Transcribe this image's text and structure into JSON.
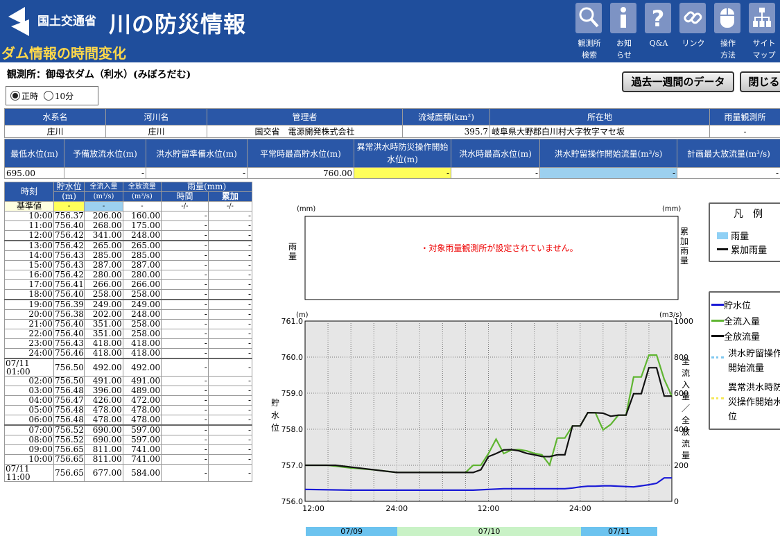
{
  "header": {
    "ministry": "国土交通省",
    "site_title": "川の防災情報",
    "page_subtitle": "ダム情報の時間変化",
    "nav": [
      {
        "icon": "search-icon",
        "label1": "観測所",
        "label2": "検索"
      },
      {
        "icon": "info-icon",
        "label1": "お知",
        "label2": "らせ"
      },
      {
        "icon": "question-icon",
        "label1": "Q&A",
        "label2": ""
      },
      {
        "icon": "link-icon",
        "label1": "リンク",
        "label2": ""
      },
      {
        "icon": "mouse-icon",
        "label1": "操作",
        "label2": "方法"
      },
      {
        "icon": "sitemap-icon",
        "label1": "サイト",
        "label2": "マップ"
      }
    ]
  },
  "station": {
    "text": "観測所：御母衣ダム（利水）(みぼろだむ)"
  },
  "buttons": {
    "past_week": "過去一週間のデータ",
    "close": "閉じる"
  },
  "radio": {
    "opt1": "正時",
    "opt2": "10分"
  },
  "info1": {
    "headers": [
      "水系名",
      "河川名",
      "管理者",
      "流域面積(km²)",
      "所在地",
      "雨量観測所"
    ],
    "values": [
      "庄川",
      "庄川",
      "国交省　電源開発株式会社",
      "395.7",
      "岐阜県大野郡白川村大字牧字マセ坂",
      "-"
    ]
  },
  "info2": {
    "headers": [
      "最低水位(m)",
      "予備放流水位(m)",
      "洪水貯留準備水位(m)",
      "平常時最高貯水位(m)",
      "異常洪水時防災操作開始水位(m)",
      "洪水時最高水位(m)",
      "洪水貯留操作開始流量(m³/s)",
      "計画最大放流量(m³/s)"
    ],
    "values": [
      "695.00",
      "-",
      "-",
      "760.00",
      "-",
      "-",
      "-",
      "-"
    ]
  },
  "data_table": {
    "headers": {
      "time": "時刻",
      "level": "貯水位",
      "level_unit": "(m)",
      "inflow": "全流入量",
      "inflow_unit": "(m³/s)",
      "outflow": "全放流量",
      "outflow_unit": "(m³/s)",
      "rain": "雨量(mm)",
      "rain_hour": "時間",
      "rain_cum": "累加"
    },
    "base_row": {
      "label": "基準値",
      "level": "-",
      "inflow": "-",
      "outflow": "-",
      "rain_hour": "-/-",
      "rain_cum": "-/-"
    },
    "rows": [
      {
        "t": "10:00",
        "lv": "756.37",
        "in": "206.00",
        "out": "160.00",
        "rh": "-",
        "rc": "-"
      },
      {
        "t": "11:00",
        "lv": "756.40",
        "in": "268.00",
        "out": "175.00",
        "rh": "-",
        "rc": "-"
      },
      {
        "t": "12:00",
        "lv": "756.42",
        "in": "341.00",
        "out": "248.00",
        "rh": "-",
        "rc": "-"
      },
      {
        "t": "13:00",
        "lv": "756.42",
        "in": "265.00",
        "out": "265.00",
        "rh": "-",
        "rc": "-",
        "g": 1
      },
      {
        "t": "14:00",
        "lv": "756.43",
        "in": "285.00",
        "out": "285.00",
        "rh": "-",
        "rc": "-"
      },
      {
        "t": "15:00",
        "lv": "756.43",
        "in": "287.00",
        "out": "287.00",
        "rh": "-",
        "rc": "-"
      },
      {
        "t": "16:00",
        "lv": "756.42",
        "in": "280.00",
        "out": "280.00",
        "rh": "-",
        "rc": "-"
      },
      {
        "t": "17:00",
        "lv": "756.41",
        "in": "266.00",
        "out": "266.00",
        "rh": "-",
        "rc": "-"
      },
      {
        "t": "18:00",
        "lv": "756.40",
        "in": "258.00",
        "out": "258.00",
        "rh": "-",
        "rc": "-"
      },
      {
        "t": "19:00",
        "lv": "756.39",
        "in": "249.00",
        "out": "249.00",
        "rh": "-",
        "rc": "-",
        "g": 1
      },
      {
        "t": "20:00",
        "lv": "756.38",
        "in": "202.00",
        "out": "248.00",
        "rh": "-",
        "rc": "-"
      },
      {
        "t": "21:00",
        "lv": "756.40",
        "in": "351.00",
        "out": "258.00",
        "rh": "-",
        "rc": "-"
      },
      {
        "t": "22:00",
        "lv": "756.40",
        "in": "351.00",
        "out": "258.00",
        "rh": "-",
        "rc": "-"
      },
      {
        "t": "23:00",
        "lv": "756.43",
        "in": "418.00",
        "out": "418.00",
        "rh": "-",
        "rc": "-"
      },
      {
        "t": "24:00",
        "lv": "756.46",
        "in": "418.00",
        "out": "418.00",
        "rh": "-",
        "rc": "-"
      },
      {
        "t": "07/11 01:00",
        "lv": "756.50",
        "in": "492.00",
        "out": "492.00",
        "rh": "-",
        "rc": "-",
        "g": 1
      },
      {
        "t": "02:00",
        "lv": "756.50",
        "in": "491.00",
        "out": "491.00",
        "rh": "-",
        "rc": "-"
      },
      {
        "t": "03:00",
        "lv": "756.48",
        "in": "396.00",
        "out": "489.00",
        "rh": "-",
        "rc": "-"
      },
      {
        "t": "04:00",
        "lv": "756.47",
        "in": "426.00",
        "out": "472.00",
        "rh": "-",
        "rc": "-"
      },
      {
        "t": "05:00",
        "lv": "756.48",
        "in": "478.00",
        "out": "478.00",
        "rh": "-",
        "rc": "-"
      },
      {
        "t": "06:00",
        "lv": "756.48",
        "in": "478.00",
        "out": "478.00",
        "rh": "-",
        "rc": "-"
      },
      {
        "t": "07:00",
        "lv": "756.52",
        "in": "690.00",
        "out": "597.00",
        "rh": "-",
        "rc": "-",
        "g": 1
      },
      {
        "t": "08:00",
        "lv": "756.52",
        "in": "690.00",
        "out": "597.00",
        "rh": "-",
        "rc": "-"
      },
      {
        "t": "09:00",
        "lv": "756.65",
        "in": "811.00",
        "out": "741.00",
        "rh": "-",
        "rc": "-"
      },
      {
        "t": "10:00",
        "lv": "756.65",
        "in": "811.00",
        "out": "741.00",
        "rh": "-",
        "rc": "-"
      },
      {
        "t": "07/11 11:00",
        "lv": "756.65",
        "in": "677.00",
        "out": "584.00",
        "rh": "-",
        "rc": "-"
      }
    ]
  },
  "rain_chart": {
    "left_unit": "(mm)",
    "right_unit": "(mm)",
    "left_label": "雨量",
    "right_label": "累加雨量",
    "message": "・対象雨量観測所が設定されていません。"
  },
  "legend1": {
    "title": "凡　例",
    "items": [
      "雨量",
      "累加雨量"
    ]
  },
  "legend2": {
    "items": [
      "貯水位",
      "全流入量",
      "全放流量",
      "洪水貯留操作開始流量",
      "異常洪水時防災操作開始水位"
    ]
  },
  "colors": {
    "header": "#1f4e9c",
    "level": "#1a1ad6",
    "inflow": "#5fb531",
    "outflow": "#111111",
    "rain": "#8fd0f5",
    "flood_start": "#7fc8f0",
    "abnormal": "#f5e85a"
  },
  "chart_data": {
    "type": "line",
    "left_unit": "(m)",
    "right_unit": "(m3/s)",
    "left_label": "貯水位",
    "right_label": "全流入量／全放流量",
    "ylim_left": [
      756.0,
      761.0
    ],
    "yticks_left": [
      "756.0",
      "757.0",
      "758.0",
      "759.0",
      "760.0",
      "761.0"
    ],
    "ylim_right": [
      0,
      1000
    ],
    "yticks_right": [
      "0",
      "200",
      "400",
      "600",
      "800",
      "1000"
    ],
    "xlim_hours": [
      0,
      48
    ],
    "xticks": [
      {
        "h": 0,
        "label": "12:00"
      },
      {
        "h": 12,
        "label": "24:00"
      },
      {
        "h": 24,
        "label": "12:00"
      },
      {
        "h": 36,
        "label": "24:00"
      }
    ],
    "dates": [
      {
        "from": 0,
        "to": 12,
        "label": "07/09"
      },
      {
        "from": 12,
        "to": 36,
        "label": "07/10"
      },
      {
        "from": 36,
        "to": 46,
        "label": "07/11"
      }
    ],
    "series": [
      {
        "name": "貯水位",
        "axis": "left",
        "color": "#1a1ad6",
        "x": [
          0,
          6,
          12,
          18,
          22,
          24,
          26,
          30,
          34,
          35,
          36,
          37,
          38,
          39,
          40,
          41,
          42,
          43,
          44,
          45,
          46,
          47,
          48
        ],
        "y": [
          756.33,
          756.31,
          756.31,
          756.31,
          756.31,
          756.33,
          756.35,
          756.35,
          756.35,
          756.37,
          756.4,
          756.42,
          756.42,
          756.43,
          756.43,
          756.42,
          756.41,
          756.4,
          756.43,
          756.46,
          756.5,
          756.65,
          756.65
        ]
      },
      {
        "name": "全流入量",
        "axis": "right",
        "color": "#5fb531",
        "x": [
          0,
          3,
          6,
          9,
          12,
          15,
          18,
          21,
          22,
          23,
          24,
          25,
          26,
          27,
          28,
          29,
          30,
          31,
          32,
          33,
          34,
          35,
          36,
          37,
          38,
          39,
          40,
          41,
          42,
          43,
          44,
          45,
          46,
          47,
          48
        ],
        "y": [
          200,
          200,
          185,
          175,
          160,
          160,
          160,
          160,
          200,
          200,
          265,
          345,
          265,
          285,
          287,
          280,
          266,
          258,
          202,
          351,
          351,
          418,
          418,
          492,
          491,
          396,
          426,
          478,
          478,
          690,
          690,
          811,
          811,
          677,
          584
        ]
      },
      {
        "name": "全放流量",
        "axis": "right",
        "color": "#111111",
        "x": [
          0,
          2,
          4,
          6,
          8,
          10,
          12,
          15,
          18,
          21,
          22,
          23,
          24,
          25,
          26,
          27,
          28,
          29,
          30,
          31,
          32,
          33,
          34,
          35,
          36,
          37,
          38,
          39,
          40,
          41,
          42,
          43,
          44,
          45,
          46,
          47,
          48
        ],
        "y": [
          200,
          200,
          200,
          190,
          180,
          170,
          160,
          160,
          160,
          160,
          160,
          175,
          248,
          265,
          285,
          287,
          280,
          266,
          258,
          249,
          248,
          258,
          258,
          418,
          418,
          492,
          491,
          489,
          472,
          478,
          478,
          597,
          597,
          741,
          741,
          584,
          584
        ]
      }
    ]
  }
}
